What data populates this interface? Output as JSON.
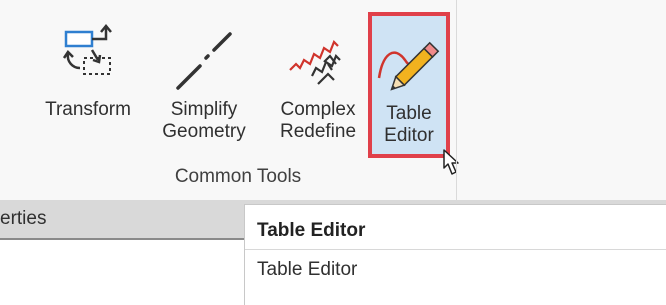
{
  "ribbon": {
    "group_label": "Common Tools",
    "tools": [
      {
        "line1": "Transform",
        "line2": "",
        "icon": "transform-icon"
      },
      {
        "line1": "Simplify",
        "line2": "Geometry",
        "icon": "simplify-geometry-icon"
      },
      {
        "line1": "Complex",
        "line2": "Redefine",
        "icon": "complex-redefine-icon"
      },
      {
        "line1": "Table",
        "line2": "Editor",
        "icon": "table-editor-icon",
        "selected": true
      }
    ],
    "highlight_color": "#e0404a",
    "selected_bg": "#cfe3f4"
  },
  "panel": {
    "title": "erties"
  },
  "tooltip": {
    "title": "Table Editor",
    "description": "Table Editor"
  }
}
